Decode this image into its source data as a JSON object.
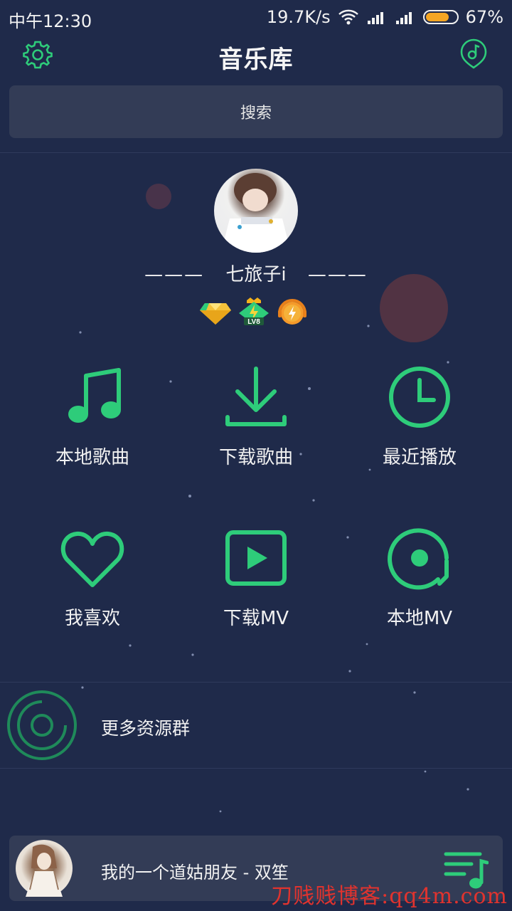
{
  "status_bar": {
    "time": "中午12:30",
    "speed": "19.7K/s",
    "battery_text": "67%"
  },
  "header": {
    "title": "音乐库"
  },
  "search": {
    "label": "搜索"
  },
  "profile": {
    "username": "七旅子i",
    "dash_left": "———",
    "dash_right": "———",
    "badges": [
      "diamond-badge-icon",
      "level-badge-icon",
      "speed-badge-icon"
    ],
    "level_text": "LV8"
  },
  "grid": {
    "items": [
      {
        "label": "本地歌曲",
        "icon": "music-note-icon"
      },
      {
        "label": "下载歌曲",
        "icon": "download-icon"
      },
      {
        "label": "最近播放",
        "icon": "clock-icon"
      },
      {
        "label": "我喜欢",
        "icon": "heart-icon"
      },
      {
        "label": "下载MV",
        "icon": "video-icon"
      },
      {
        "label": "本地MV",
        "icon": "local-mv-icon"
      }
    ]
  },
  "resource": {
    "label": "更多资源群"
  },
  "player": {
    "title": "我的一个道姑朋友 - 双笙"
  },
  "watermark": "刀贱贱博客:qq4m.com",
  "colors": {
    "background": "#1f2a4a",
    "panel": "#333c56",
    "accent": "#2ecc7a"
  }
}
